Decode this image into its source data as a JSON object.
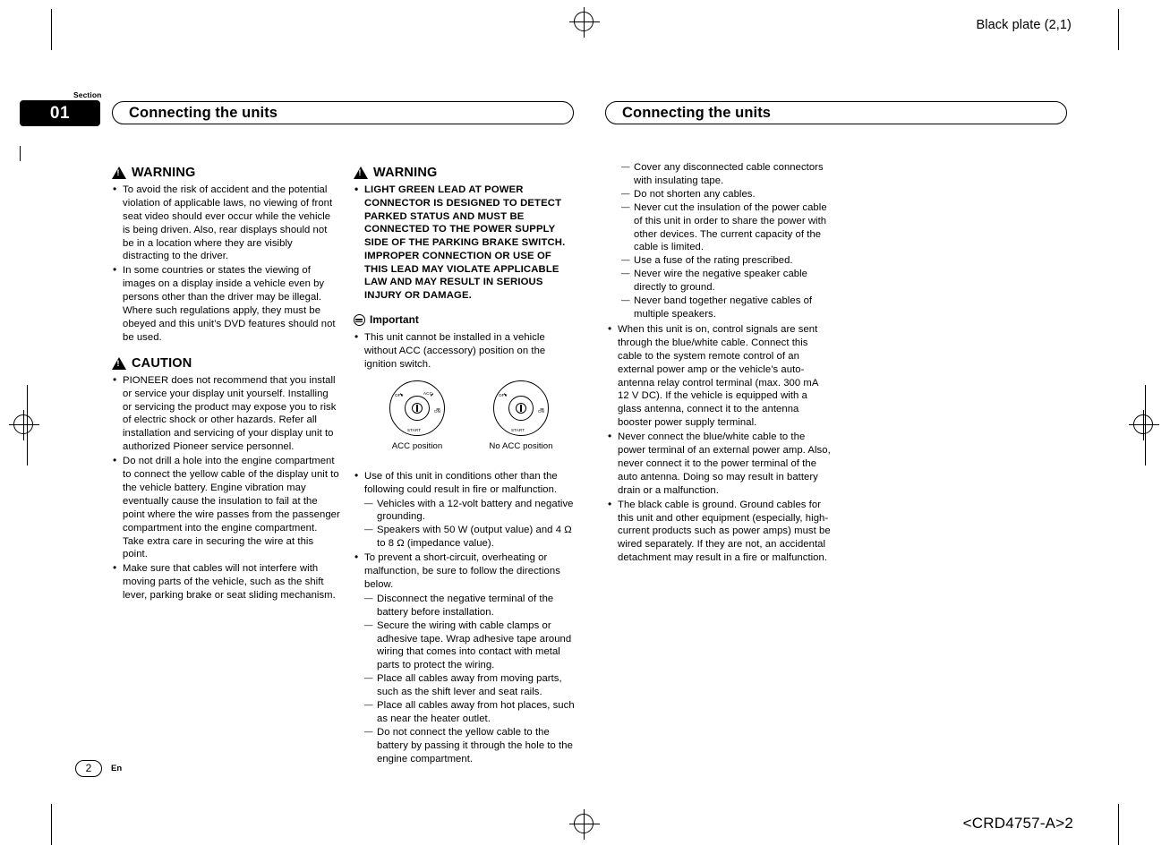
{
  "plate": {
    "label": "Black plate (2,1)",
    "crd": "<CRD4757-A>2"
  },
  "section": {
    "label": "Section",
    "number": "01"
  },
  "headers": {
    "left": "Connecting the units",
    "right": "Connecting the units"
  },
  "footer": {
    "page": "2",
    "lang": "En"
  },
  "col1": {
    "warning_title": "WARNING",
    "warning_items": [
      "To avoid the risk of accident and the potential violation of applicable laws, no viewing of front seat video should ever occur while the vehicle is being driven. Also, rear displays should not be in a location where they are visibly distracting to the driver.",
      "In some countries or states the viewing of images on a display inside a vehicle even by persons other than the driver may be illegal. Where such regulations apply, they must be obeyed and this unit’s DVD features should not be used."
    ],
    "caution_title": "CAUTION",
    "caution_items": [
      "PIONEER does not recommend that you install or service your display unit yourself. Installing or servicing the product may expose you to risk of electric shock or other hazards. Refer all installation and servicing of your display unit to authorized Pioneer service personnel.",
      "Do not drill a hole into the engine compartment to connect the yellow cable of the display unit to the vehicle battery. Engine vibration may eventually cause the insulation to fail at the point where the wire passes from the passenger compartment into the engine compartment. Take extra care in securing the wire at this point.",
      "Make sure that cables will not interfere with moving parts of the vehicle, such as the shift lever, parking brake or seat sliding mechanism."
    ]
  },
  "col2": {
    "warning_title": "WARNING",
    "warning_items": [
      "LIGHT GREEN LEAD AT POWER CONNECTOR IS DESIGNED TO DETECT PARKED STATUS AND MUST BE CONNECTED TO THE POWER SUPPLY SIDE OF THE PARKING BRAKE SWITCH. IMPROPER CONNECTION OR USE OF THIS LEAD MAY VIOLATE APPLICABLE LAW AND MAY RESULT IN SERIOUS INJURY OR DAMAGE."
    ],
    "important_title": "Important",
    "important_items": [
      "This unit cannot be installed in a vehicle without ACC (accessory) position on the ignition switch."
    ],
    "figures": [
      {
        "caption": "ACC position",
        "labels": [
          "OFF",
          "ACC",
          "ON",
          "START"
        ]
      },
      {
        "caption": "No ACC position",
        "labels": [
          "OFF",
          "ON",
          "START"
        ]
      }
    ],
    "bullets": [
      {
        "text": "Use of this unit in conditions other than the following could result in fire or malfunction.",
        "dashes": [
          "Vehicles with a 12-volt battery and negative grounding.",
          "Speakers with 50 W (output value) and 4 Ω to 8 Ω (impedance value)."
        ]
      },
      {
        "text": "To prevent a short-circuit, overheating or malfunction, be sure to follow the directions below.",
        "dashes": [
          "Disconnect the negative terminal of the battery before installation.",
          "Secure the wiring with cable clamps or adhesive tape. Wrap adhesive tape around wiring that comes into contact with metal parts to protect the wiring.",
          "Place all cables away from moving parts, such as the shift lever and seat rails.",
          "Place all cables away from hot places, such as near the heater outlet.",
          "Do not connect the yellow cable to the battery by passing it through the hole to the engine compartment."
        ]
      }
    ]
  },
  "col3": {
    "top_dashes": [
      "Cover any disconnected cable connectors with insulating tape.",
      "Do not shorten any cables.",
      "Never cut the insulation of the power cable of this unit in order to share the power with other devices. The current capacity of the cable is limited.",
      "Use a fuse of the rating prescribed.",
      "Never wire the negative speaker cable directly to ground.",
      "Never band together negative cables of multiple speakers."
    ],
    "bullets": [
      "When this unit is on, control signals are sent through the blue/white cable. Connect this cable to the system remote control of an external power amp or the vehicle’s auto-antenna relay control terminal (max. 300 mA 12 V DC). If the vehicle is equipped with a glass antenna, connect it to the antenna booster power supply terminal.",
      "Never connect the blue/white cable to the power terminal of an external power amp. Also, never connect it to the power terminal of the auto antenna. Doing so may result in battery drain or a malfunction.",
      "The black cable is ground. Ground cables for this unit and other equipment (especially, high-current products such as power amps) must be wired separately. If they are not, an accidental detachment may result in a fire or malfunction."
    ]
  }
}
